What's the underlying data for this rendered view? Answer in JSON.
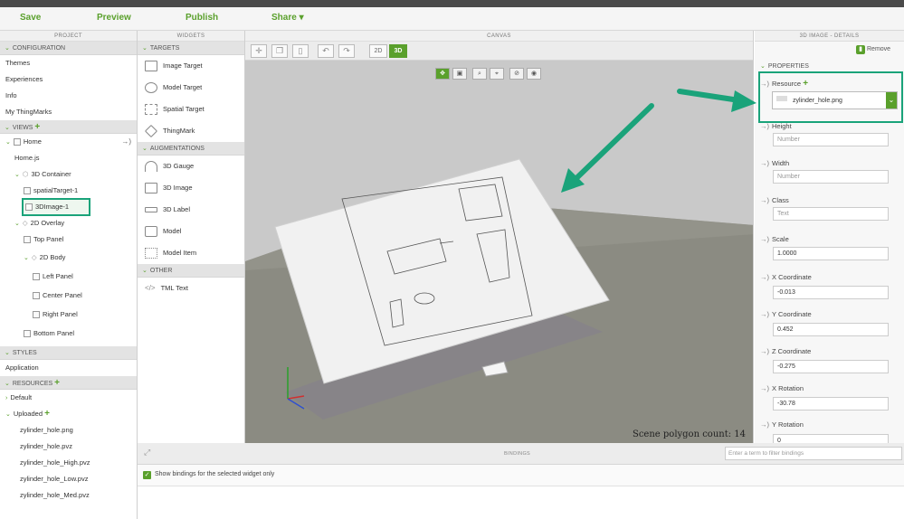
{
  "toolbar": {
    "save": "Save",
    "preview": "Preview",
    "publish": "Publish",
    "share": "Share"
  },
  "project": {
    "title": "PROJECT",
    "configuration": "CONFIGURATION",
    "config_items": [
      "Themes",
      "Experiences",
      "Info",
      "My ThingMarks"
    ],
    "views": "VIEWS",
    "home": "Home",
    "homejs": "Home.js",
    "container": "3D Container",
    "spatial": "spatialTarget-1",
    "image": "3DImage-1",
    "overlay": "2D Overlay",
    "top_panel": "Top Panel",
    "body_2d": "2D Body",
    "left_panel": "Left Panel",
    "center_panel": "Center Panel",
    "right_panel": "Right Panel",
    "bottom_panel": "Bottom Panel",
    "styles": "STYLES",
    "application": "Application",
    "resources": "RESOURCES",
    "default": "Default",
    "uploaded": "Uploaded",
    "files": [
      "zylinder_hole.png",
      "zylinder_hole.pvz",
      "zylinder_hole_High.pvz",
      "zylinder_hole_Low.pvz",
      "zylinder_hole_Med.pvz"
    ]
  },
  "widgets": {
    "title": "WIDGETS",
    "targets": "TARGETS",
    "target_items": [
      "Image Target",
      "Model Target",
      "Spatial Target",
      "ThingMark"
    ],
    "augmentations": "AUGMENTATIONS",
    "aug_items": [
      "3D Gauge",
      "3D Image",
      "3D Label",
      "Model",
      "Model Item"
    ],
    "other": "OTHER",
    "other_items": [
      "TML Text"
    ]
  },
  "canvas": {
    "title": "CANVAS",
    "btn_2d": "2D",
    "btn_3d": "3D",
    "polygon_count": "Scene polygon count: 14"
  },
  "details": {
    "title": "3D IMAGE",
    "subtitle": " - DETAILS",
    "remove": "Remove",
    "properties": "PROPERTIES",
    "resource_label": "Resource",
    "resource_value": "zylinder_hole.png",
    "height_label": "Height",
    "height_ph": "Number",
    "width_label": "Width",
    "width_ph": "Number",
    "class_label": "Class",
    "class_ph": "Text",
    "scale_label": "Scale",
    "scale_value": "1.0000",
    "x_label": "X Coordinate",
    "x_value": "-0.013",
    "y_label": "Y Coordinate",
    "y_value": "0.452",
    "z_label": "Z Coordinate",
    "z_value": "-0.275",
    "xrot_label": "X Rotation",
    "xrot_value": "-30.78",
    "yrot_label": "Y Rotation",
    "yrot_value": "0"
  },
  "bindings": {
    "title": "BINDINGS",
    "filter_ph": "Enter a term to filter bindings",
    "show_selected": "Show bindings for the selected widget only"
  },
  "colors": {
    "accent": "#5aa02c",
    "annotation": "#1aa37a"
  }
}
